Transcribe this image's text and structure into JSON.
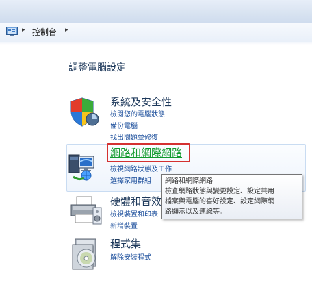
{
  "address_bar": {
    "icon": "control-panel-icon",
    "separator": "▸",
    "crumb": "控制台"
  },
  "page_title": "調整電腦設定",
  "categories": [
    {
      "title": "系統及安全性",
      "icon": "shield-icon",
      "links": [
        "檢閱您的電腦狀態",
        "備份電腦",
        "找出問題並修復"
      ]
    },
    {
      "title": "網路和網際網路",
      "icon": "network-icon",
      "links": [
        "檢視網路狀態及工作",
        "選擇家用群組"
      ]
    },
    {
      "title": "硬體和音效",
      "icon": "printer-icon",
      "links": [
        "檢視裝置和印表",
        "新增裝置"
      ]
    },
    {
      "title": "程式集",
      "icon": "programs-icon",
      "links": [
        "解除安裝程式"
      ]
    }
  ],
  "tooltip": {
    "lines": [
      "網路和網際網路",
      "檢查網路狀態與變更設定、設定共用",
      "檔案與電腦的喜好設定、設定網際網",
      "路顯示以及連線等。"
    ]
  },
  "colors": {
    "link": "#1a4d9b",
    "hover_link": "#119a2d",
    "focus": "#d43131"
  }
}
